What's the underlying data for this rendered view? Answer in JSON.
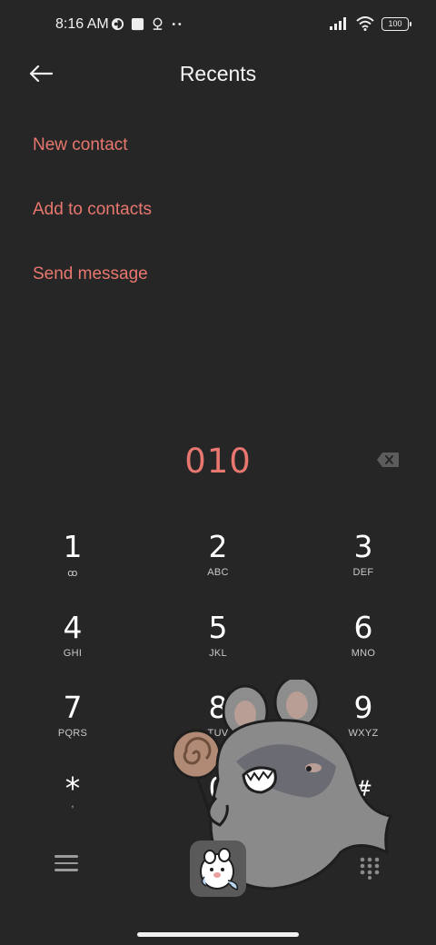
{
  "status_bar": {
    "time": "8:16 AM",
    "battery": "100",
    "icons": [
      "notification-icon",
      "square-icon",
      "location-icon",
      "more-dots-icon",
      "signal-icon",
      "wifi-icon",
      "battery-icon"
    ]
  },
  "header": {
    "title": "Recents",
    "back_icon": "back-arrow-icon"
  },
  "actions": {
    "new_contact": "New contact",
    "add_to_contacts": "Add to contacts",
    "send_message": "Send message"
  },
  "dialer": {
    "number": "010",
    "backspace_icon": "backspace-icon"
  },
  "keypad": {
    "k1": {
      "digit": "1",
      "letters": "ꝏ"
    },
    "k2": {
      "digit": "2",
      "letters": "ABC"
    },
    "k3": {
      "digit": "3",
      "letters": "DEF"
    },
    "k4": {
      "digit": "4",
      "letters": "GHI"
    },
    "k5": {
      "digit": "5",
      "letters": "JKL"
    },
    "k6": {
      "digit": "6",
      "letters": "MNO"
    },
    "k7": {
      "digit": "7",
      "letters": "PQRS"
    },
    "k8": {
      "digit": "8",
      "letters": "TUV"
    },
    "k9": {
      "digit": "9",
      "letters": "WXYZ"
    },
    "kstar": {
      "digit": "*",
      "letters": ","
    },
    "k0": {
      "digit": "0",
      "letters": "+"
    },
    "khash": {
      "digit": "#",
      "letters": ""
    }
  },
  "bottom_bar": {
    "menu_icon": "menu-icon",
    "call_icon": "call-sticker-icon",
    "dialpad_icon": "dialpad-icon"
  },
  "colors": {
    "background": "#262626",
    "accent": "#e8776f",
    "text": "#ffffff"
  }
}
